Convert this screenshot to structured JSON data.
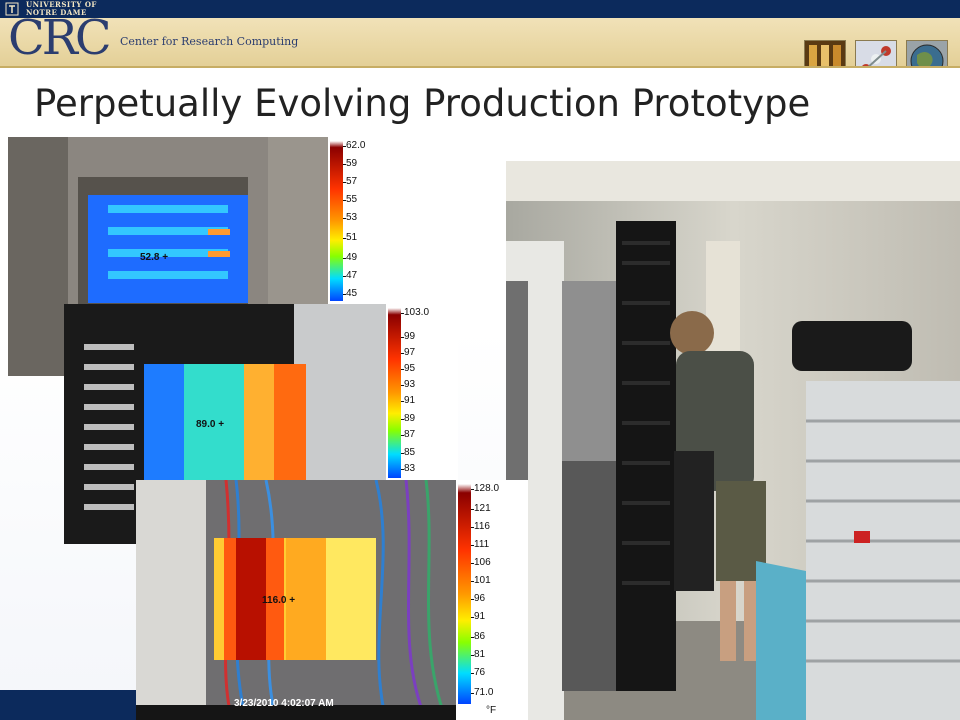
{
  "header": {
    "university": "UNIVERSITY OF\nNOTRE DAME",
    "logo": "CRC",
    "subtitle": "Center for Research Computing",
    "thumbnails": [
      "server-cluster-thumbnail",
      "molecule-thumbnail",
      "globe-thumbnail"
    ]
  },
  "slide": {
    "title": "Perpetually Evolving Production Prototype"
  },
  "thermal_images": [
    {
      "name": "thermal-image-vent",
      "crosshair": "52.8 +",
      "scale": [
        "62.0",
        "59",
        "57",
        "55",
        "53",
        "51",
        "49",
        "47",
        "45"
      ]
    },
    {
      "name": "thermal-image-rack",
      "crosshair": "89.0 +",
      "scale": [
        "103.0",
        "99",
        "97",
        "95",
        "93",
        "91",
        "89",
        "87",
        "85",
        "83"
      ]
    },
    {
      "name": "thermal-image-cabling",
      "crosshair": "116.0 +",
      "scale": [
        "128.0",
        "121",
        "116",
        "111",
        "106",
        "101",
        "96",
        "91",
        "86",
        "81",
        "76",
        "71.0"
      ],
      "timestamp": "3/23/2010 4:02:07 AM",
      "unit": "°F"
    }
  ],
  "photo": {
    "name": "container-datacenter-photo"
  },
  "colors": {
    "navy": "#0c2a5c",
    "header_gold": "#e3cf96",
    "logo_blue": "#2b3d6f"
  }
}
